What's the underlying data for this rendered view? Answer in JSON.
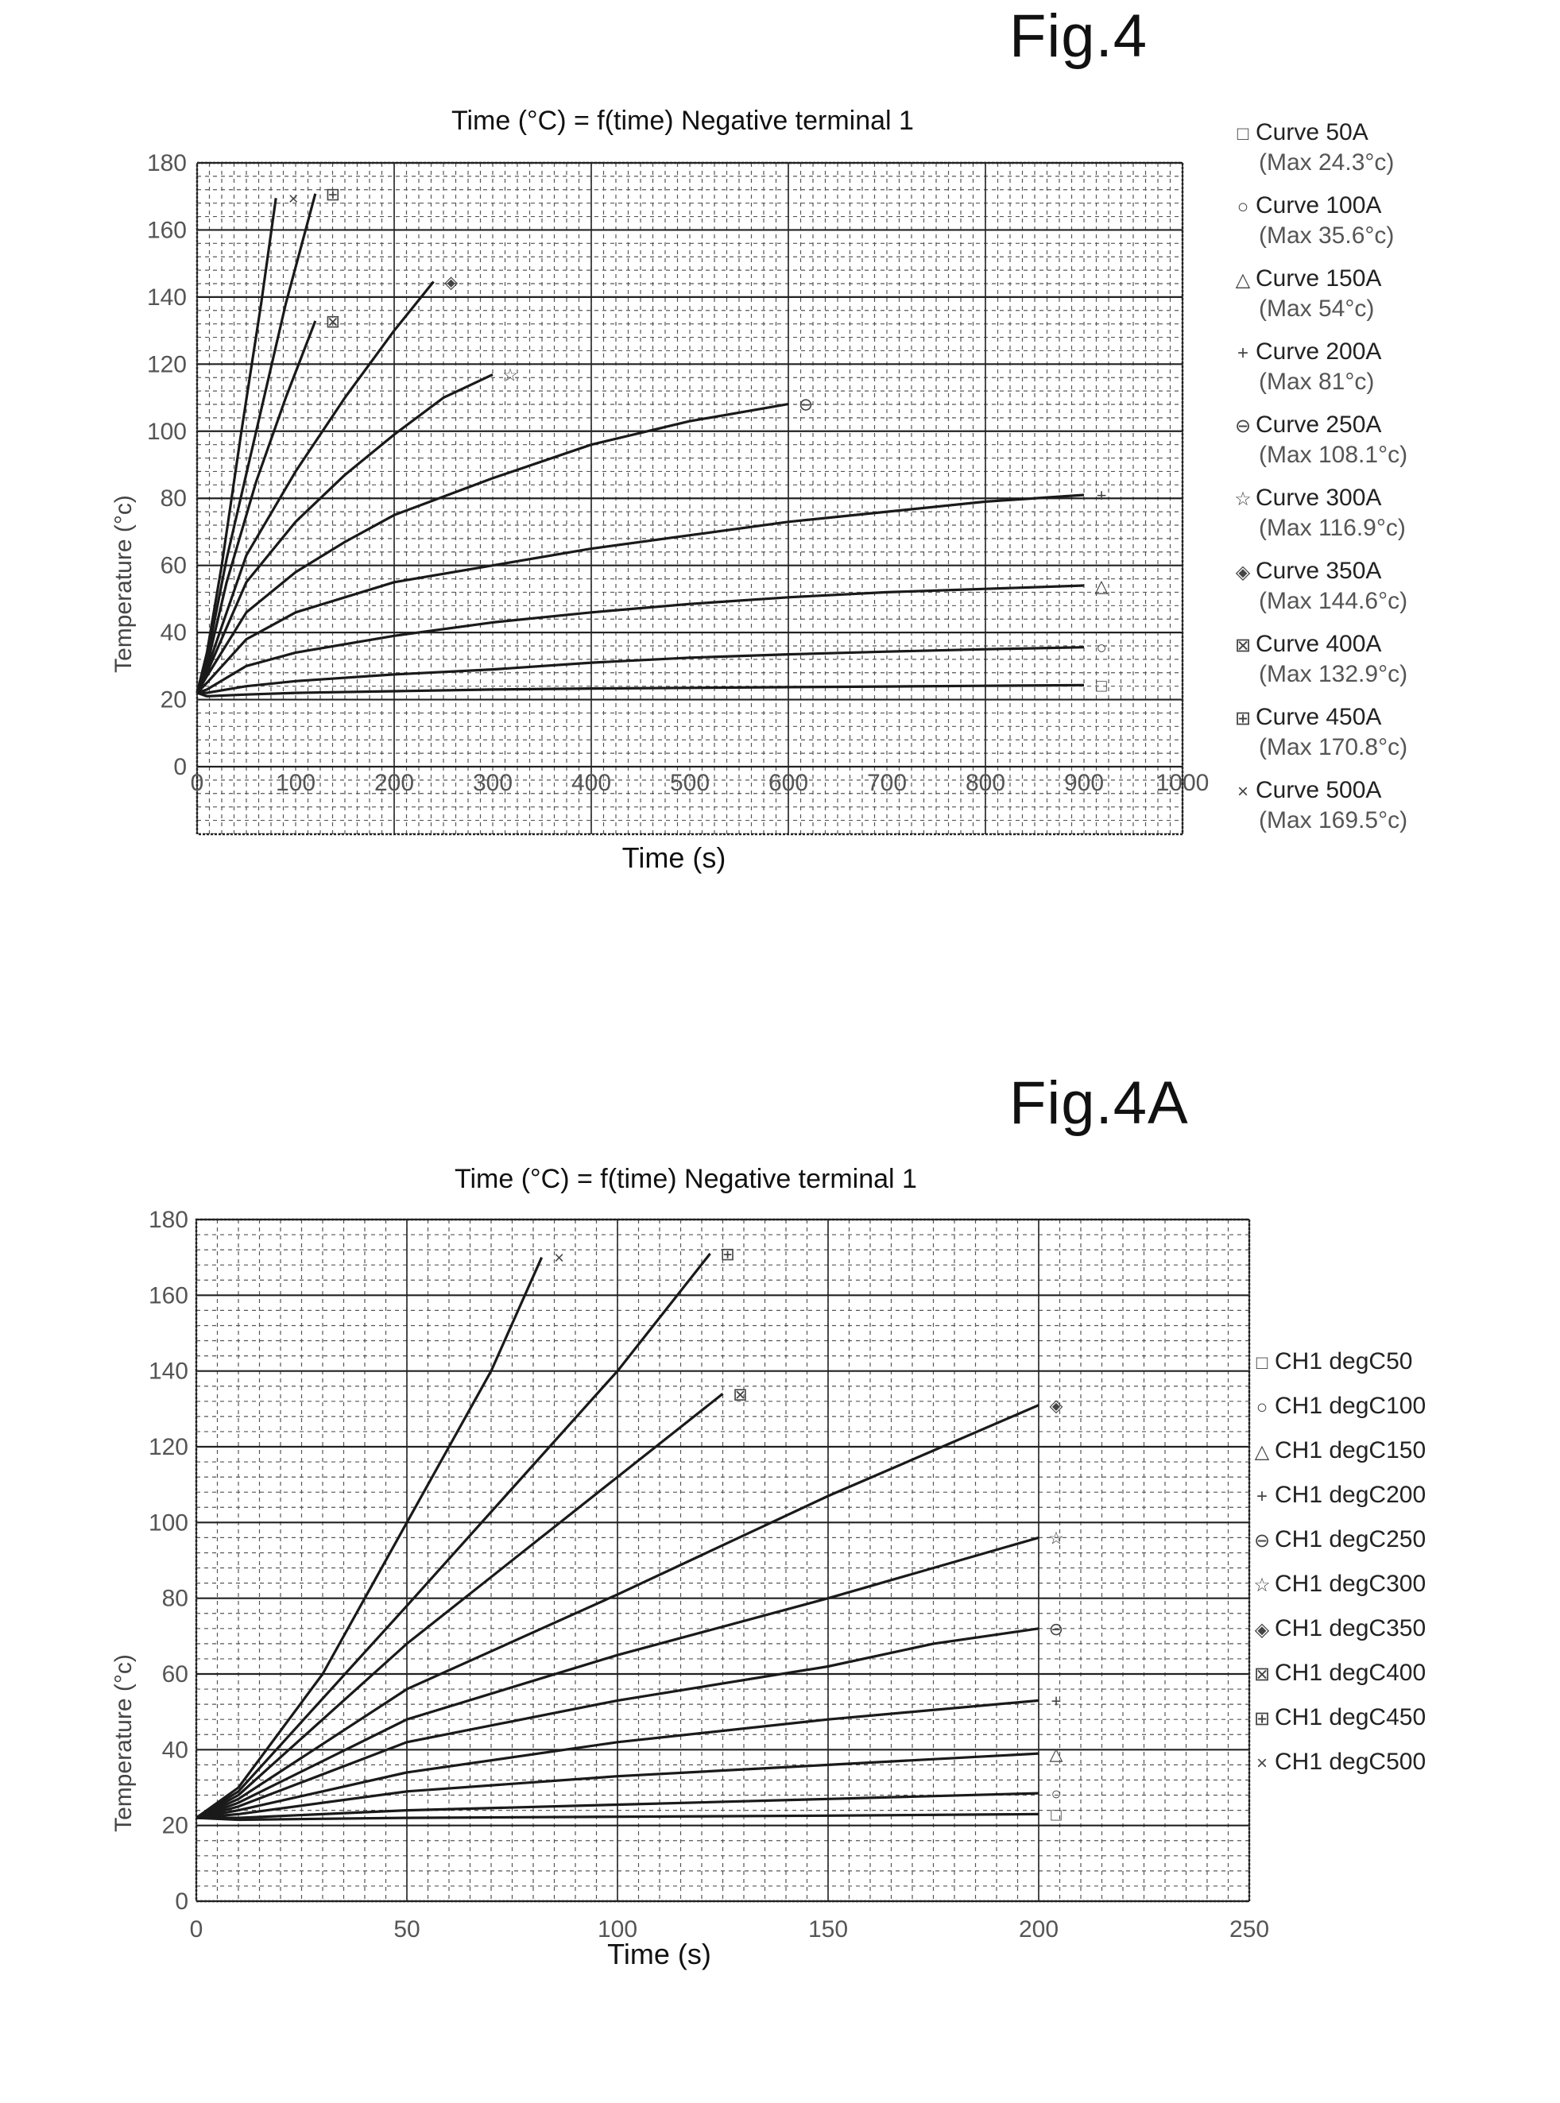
{
  "figures": [
    {
      "id": "fig4",
      "label": "Fig.4",
      "title": "Time (°C) = f(time) Negative terminal 1",
      "legend": [
        {
          "marker": "□",
          "label": "Curve  50A",
          "sub": "(Max 24.3°c)"
        },
        {
          "marker": "○",
          "label": "Curve  100A",
          "sub": "(Max 35.6°c)"
        },
        {
          "marker": "△",
          "label": "Curve  150A",
          "sub": "(Max 54°c)"
        },
        {
          "marker": "+",
          "label": "Curve  200A",
          "sub": "(Max 81°c)"
        },
        {
          "marker": "⊖",
          "label": "Curve  250A",
          "sub": "(Max 108.1°c)"
        },
        {
          "marker": "☆",
          "label": "Curve  300A",
          "sub": "(Max 116.9°c)"
        },
        {
          "marker": "◈",
          "label": "Curve  350A",
          "sub": "(Max 144.6°c)"
        },
        {
          "marker": "⊠",
          "label": "Curve  400A",
          "sub": "(Max 132.9°c)"
        },
        {
          "marker": "⊞",
          "label": "Curve  450A",
          "sub": "(Max 170.8°c)"
        },
        {
          "marker": "×",
          "label": "Curve  500A",
          "sub": "(Max 169.5°c)"
        }
      ]
    },
    {
      "id": "fig4a",
      "label": "Fig.4A",
      "title": "Time (°C) = f(time) Negative terminal 1",
      "legend": [
        {
          "marker": "□",
          "label": "CH1 degC50"
        },
        {
          "marker": "○",
          "label": "CH1 degC100"
        },
        {
          "marker": "△",
          "label": "CH1 degC150"
        },
        {
          "marker": "+",
          "label": "CH1 degC200"
        },
        {
          "marker": "⊖",
          "label": "CH1 degC250"
        },
        {
          "marker": "☆",
          "label": "CH1 degC300"
        },
        {
          "marker": "◈",
          "label": "CH1 degC350"
        },
        {
          "marker": "⊠",
          "label": "CH1 degC400"
        },
        {
          "marker": "⊞",
          "label": "CH1 degC450"
        },
        {
          "marker": "×",
          "label": "CH1 degC500"
        }
      ]
    }
  ],
  "chart_data": [
    {
      "type": "line",
      "title": "Time (°C) = f(time) Negative terminal 1",
      "xlabel": "Time (s)",
      "ylabel": "Temperature (°c)",
      "xlim": [
        0,
        1000
      ],
      "ylim": [
        0,
        180
      ],
      "xticks": [
        0,
        100,
        200,
        300,
        400,
        500,
        600,
        700,
        800,
        900,
        1000
      ],
      "yticks": [
        0,
        20,
        40,
        60,
        80,
        100,
        120,
        140,
        160,
        180
      ],
      "grid": true,
      "legend_position": "right",
      "series": [
        {
          "name": "Curve 50A",
          "marker": "□",
          "x": [
            0,
            10,
            50,
            100,
            200,
            300,
            400,
            500,
            600,
            700,
            800,
            900
          ],
          "y": [
            22,
            21,
            21.5,
            22,
            22.5,
            23,
            23.3,
            23.5,
            23.7,
            23.9,
            24.1,
            24.3
          ]
        },
        {
          "name": "Curve 100A",
          "marker": "○",
          "x": [
            0,
            10,
            50,
            100,
            200,
            300,
            400,
            500,
            600,
            700,
            800,
            900
          ],
          "y": [
            22,
            22,
            24,
            25.5,
            27.5,
            29,
            31,
            32.5,
            33.5,
            34.3,
            35,
            35.6
          ]
        },
        {
          "name": "Curve 150A",
          "marker": "△",
          "x": [
            0,
            10,
            50,
            100,
            200,
            300,
            400,
            500,
            600,
            700,
            800,
            900
          ],
          "y": [
            22,
            23,
            30,
            34,
            39,
            43,
            46,
            48.5,
            50.5,
            52,
            53,
            54
          ]
        },
        {
          "name": "Curve 200A",
          "marker": "+",
          "x": [
            0,
            10,
            50,
            100,
            200,
            300,
            400,
            500,
            600,
            700,
            800,
            900
          ],
          "y": [
            22,
            25,
            38,
            46,
            55,
            60,
            65,
            69,
            73,
            76,
            79,
            81
          ]
        },
        {
          "name": "Curve 250A",
          "marker": "⊖",
          "x": [
            0,
            10,
            50,
            100,
            150,
            200,
            300,
            400,
            500,
            600
          ],
          "y": [
            22,
            27,
            46,
            58,
            67,
            75,
            86,
            96,
            103,
            108.1
          ]
        },
        {
          "name": "Curve 300A",
          "marker": "☆",
          "x": [
            0,
            10,
            50,
            100,
            150,
            200,
            250,
            300
          ],
          "y": [
            22,
            28,
            55,
            73,
            87,
            99,
            110,
            116.9
          ]
        },
        {
          "name": "Curve 350A",
          "marker": "◈",
          "x": [
            0,
            10,
            50,
            100,
            150,
            200,
            240
          ],
          "y": [
            22,
            29,
            63,
            88,
            110,
            130,
            144.6
          ]
        },
        {
          "name": "Curve 400A",
          "marker": "⊠",
          "x": [
            0,
            10,
            30,
            60,
            90,
            120
          ],
          "y": [
            22,
            30,
            55,
            85,
            110,
            132.9
          ]
        },
        {
          "name": "Curve 450A",
          "marker": "⊞",
          "x": [
            0,
            10,
            30,
            60,
            90,
            120
          ],
          "y": [
            22,
            32,
            62,
            100,
            138,
            170.8
          ]
        },
        {
          "name": "Curve 500A",
          "marker": "×",
          "x": [
            0,
            10,
            25,
            45,
            65,
            80
          ],
          "y": [
            22,
            34,
            60,
            100,
            138,
            169.5
          ]
        }
      ]
    },
    {
      "type": "line",
      "title": "Time (°C) = f(time) Negative terminal 1",
      "xlabel": "Time (s)",
      "ylabel": "Temperature (°c)",
      "xlim": [
        0,
        250
      ],
      "ylim": [
        0,
        180
      ],
      "xticks": [
        0,
        50,
        100,
        150,
        200,
        250
      ],
      "yticks": [
        0,
        20,
        40,
        60,
        80,
        100,
        120,
        140,
        160,
        180
      ],
      "grid": true,
      "legend_position": "right",
      "series": [
        {
          "name": "CH1 degC50",
          "marker": "□",
          "x": [
            0,
            10,
            50,
            100,
            150,
            200
          ],
          "y": [
            22,
            21.5,
            22,
            22.3,
            22.6,
            23
          ]
        },
        {
          "name": "CH1 degC100",
          "marker": "○",
          "x": [
            0,
            10,
            50,
            100,
            150,
            200
          ],
          "y": [
            22,
            22,
            24,
            25.5,
            27,
            28.5
          ]
        },
        {
          "name": "CH1 degC150",
          "marker": "△",
          "x": [
            0,
            10,
            50,
            100,
            150,
            200
          ],
          "y": [
            22,
            23,
            29,
            33,
            36,
            39
          ]
        },
        {
          "name": "CH1 degC200",
          "marker": "+",
          "x": [
            0,
            10,
            50,
            100,
            150,
            200
          ],
          "y": [
            22,
            24,
            34,
            42,
            48,
            53
          ]
        },
        {
          "name": "CH1 degC250",
          "marker": "⊖",
          "x": [
            0,
            10,
            50,
            100,
            150,
            175,
            200
          ],
          "y": [
            22,
            25,
            42,
            53,
            62,
            68,
            72
          ]
        },
        {
          "name": "CH1 degC300",
          "marker": "☆",
          "x": [
            0,
            10,
            50,
            100,
            150,
            200
          ],
          "y": [
            22,
            26,
            48,
            65,
            80,
            96
          ]
        },
        {
          "name": "CH1 degC350",
          "marker": "◈",
          "x": [
            0,
            10,
            50,
            100,
            150,
            200
          ],
          "y": [
            22,
            27,
            56,
            81,
            107,
            131
          ]
        },
        {
          "name": "CH1 degC400",
          "marker": "⊠",
          "x": [
            0,
            10,
            50,
            100,
            125
          ],
          "y": [
            22,
            28,
            68,
            112,
            134
          ]
        },
        {
          "name": "CH1 degC450",
          "marker": "⊞",
          "x": [
            0,
            10,
            50,
            100,
            122
          ],
          "y": [
            22,
            29,
            78,
            140,
            171
          ]
        },
        {
          "name": "CH1 degC500",
          "marker": "×",
          "x": [
            0,
            10,
            30,
            50,
            70,
            82
          ],
          "y": [
            22,
            30,
            60,
            100,
            140,
            170
          ]
        }
      ]
    }
  ]
}
